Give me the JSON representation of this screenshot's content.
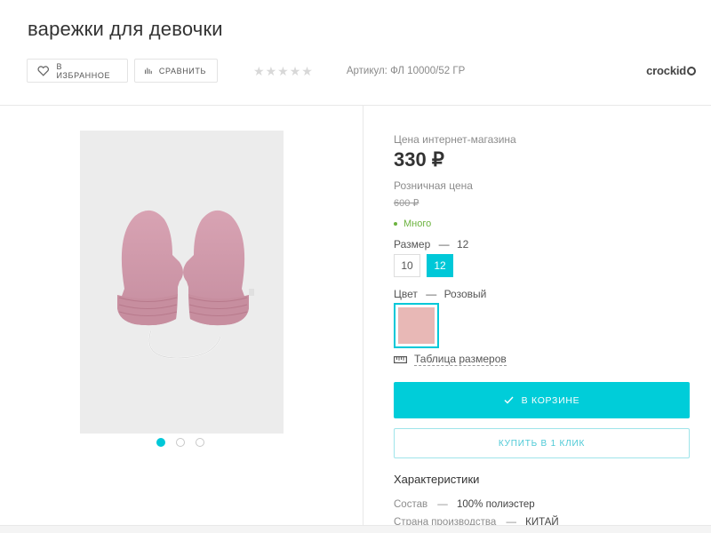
{
  "product": {
    "title": "варежки для девочки",
    "sku": "Артикул: ФЛ 10000/52 ГР",
    "brand": "crockid"
  },
  "toolbar": {
    "favorite_label": "В ИЗБРАННОЕ",
    "compare_label": "СРАВНИТЬ",
    "rating_stars": "★★★★★",
    "rating_value": 0
  },
  "pricing": {
    "online_label": "Цена интернет-магазина",
    "online_price": "330 ₽",
    "retail_label": "Розничная цена",
    "retail_price": "600 ₽",
    "availability": "Много"
  },
  "size": {
    "label": "Размер",
    "dash": "—",
    "selected": "12",
    "options": [
      "10",
      "12"
    ]
  },
  "color": {
    "label": "Цвет",
    "dash": "—",
    "selected": "Розовый",
    "swatch_hex": "#e8b8b6"
  },
  "size_table_link": "Таблица размеров",
  "buttons": {
    "cart_label": "В КОРЗИНЕ",
    "quick_buy_label": "КУПИТЬ В 1 КЛИК"
  },
  "gallery": {
    "slide_count": 3,
    "active_slide": 1
  },
  "characteristics": {
    "title": "Характеристики",
    "rows": [
      {
        "name": "Состав",
        "dash": "—",
        "value": "100% полиэстер"
      },
      {
        "name": "Страна производства",
        "dash": "—",
        "value": "КИТАЙ"
      }
    ]
  },
  "colors": {
    "accent": "#00cdd9",
    "availability": "#6cb33f"
  }
}
